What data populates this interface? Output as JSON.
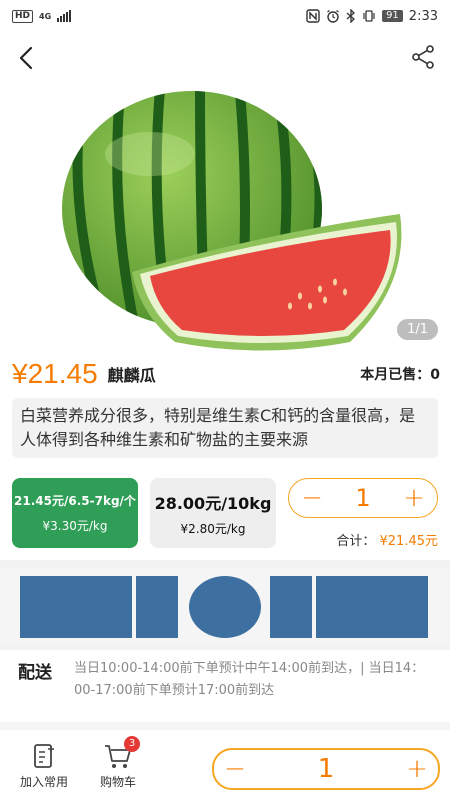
{
  "status_bar": {
    "hd": "HD",
    "network": "4G",
    "battery": "91",
    "time": "2:33",
    "icons": [
      "nfc-icon",
      "alarm-icon",
      "bluetooth-icon",
      "vibrate-icon"
    ]
  },
  "nav": {
    "back_icon": "chevron-left-icon",
    "share_icon": "share-icon"
  },
  "gallery": {
    "image": "watermelon-photo",
    "indicator": "1/1"
  },
  "product": {
    "price": "¥21.45",
    "name": "麒麟瓜",
    "sold_label": "本月已售：",
    "sold_count": "0",
    "description": "白菜营养成分很多，特别是维生素C和钙的含量很高，是人体得到各种维生素和矿物盐的主要来源"
  },
  "specs": [
    {
      "title": "21.45元/6.5-7kg/个",
      "unit_price": "¥3.30元/kg",
      "selected": true
    },
    {
      "title": "28.00元/10kg",
      "unit_price": "¥2.80元/kg",
      "selected": false
    }
  ],
  "quantity": {
    "minus": "−",
    "value": "1",
    "plus": "+"
  },
  "total": {
    "label": "合计：",
    "value": "¥21.45元"
  },
  "delivery": {
    "label": "配送",
    "text": "当日10:00-14:00前下单预计中午14:00前到达，| 当日14：00-17:00前下单预计17:00前到达"
  },
  "bottom_bar": {
    "add_frequent_label": "加入常用",
    "cart_label": "购物车",
    "cart_badge": "3",
    "quantity": "1"
  },
  "colors": {
    "accent": "#f57c00",
    "stepper_border": "#f5a623",
    "selected_spec": "#2f9e57",
    "badge": "#e53935",
    "banner_blue": "#3d6fa0"
  }
}
